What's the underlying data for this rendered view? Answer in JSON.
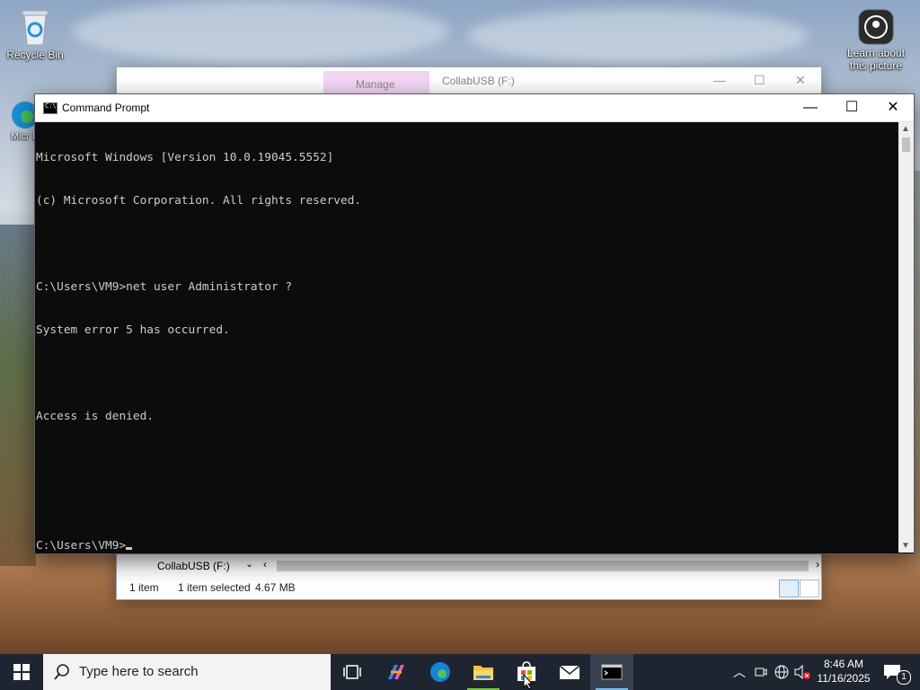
{
  "desktop": {
    "recycle_bin_label": "Recycle Bin",
    "edge_label_partial": "Micr Ed",
    "learn_picture_label": "Learn about this picture"
  },
  "explorer": {
    "tab_manage": "Manage",
    "tab_collab": "CollabUSB (F:)",
    "sidebar_drive": "CollabUSB (F:)",
    "status_items": "1 item",
    "status_selected": "1 item selected",
    "status_size": "4.67 MB"
  },
  "cmd": {
    "title": "Command Prompt",
    "lines": [
      "Microsoft Windows [Version 10.0.19045.5552]",
      "(c) Microsoft Corporation. All rights reserved.",
      "",
      "C:\\Users\\VM9>net user Administrator ?",
      "System error 5 has occurred.",
      "",
      "Access is denied.",
      "",
      "",
      "C:\\Users\\VM9>"
    ]
  },
  "taskbar": {
    "search_placeholder": "Type here to search",
    "time": "8:46 AM",
    "date": "11/16/2025",
    "notification_count": "1"
  },
  "colors": {
    "console_bg": "#0c0c0c",
    "console_fg": "#cccccc",
    "taskbar_bg": "#1f2530",
    "active_indicator": "#76b9ed"
  }
}
